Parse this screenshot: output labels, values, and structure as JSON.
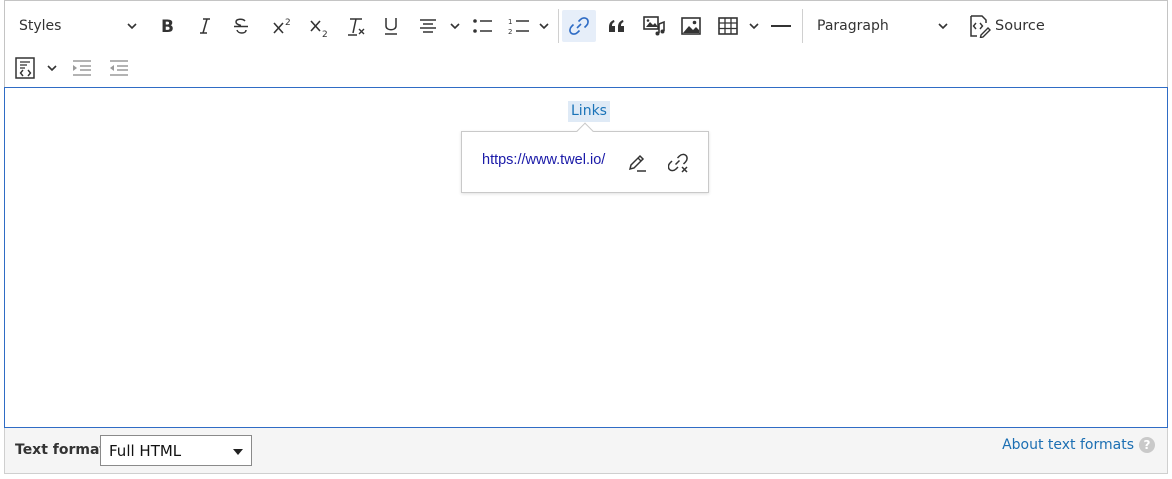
{
  "toolbar": {
    "styles_label": "Styles",
    "heading_label": "Paragraph",
    "source_label": "Source"
  },
  "content": {
    "link_text": "Links"
  },
  "link_balloon": {
    "url": "https://www.twel.io/"
  },
  "footer": {
    "text_format_label": "Text format",
    "text_format_value": "Full HTML",
    "about_link": "About text formats",
    "help_glyph": "?"
  },
  "colors": {
    "accent": "#2f6cc5",
    "link": "#1a1aa8",
    "link_highlight": "#dfeaf6"
  }
}
